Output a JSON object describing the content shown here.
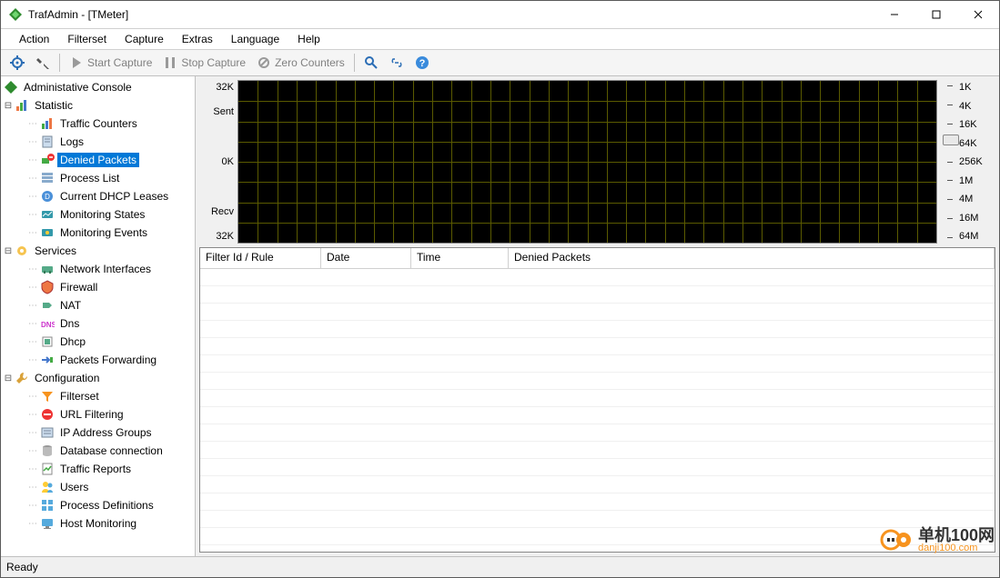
{
  "title": "TrafAdmin - [TMeter]",
  "menubar": [
    "Action",
    "Filterset",
    "Capture",
    "Extras",
    "Language",
    "Help"
  ],
  "toolbar": {
    "gear1": "settings-icon",
    "gear2": "wrench-icon",
    "start": "Start Capture",
    "stop": "Stop Capture",
    "zero": "Zero Counters",
    "search": "search-icon",
    "link": "link-icon",
    "help": "help-icon"
  },
  "tree": {
    "root": "Administative Console",
    "statistic": {
      "label": "Statistic",
      "items": [
        "Traffic Counters",
        "Logs",
        "Denied Packets",
        "Process List",
        "Current DHCP Leases",
        "Monitoring States",
        "Monitoring Events"
      ]
    },
    "services": {
      "label": "Services",
      "items": [
        "Network Interfaces",
        "Firewall",
        "NAT",
        "Dns",
        "Dhcp",
        "Packets Forwarding"
      ]
    },
    "configuration": {
      "label": "Configuration",
      "items": [
        "Filterset",
        "URL Filtering",
        "IP Address Groups",
        "Database connection",
        "Traffic Reports",
        "Users",
        "Process Definitions",
        "Host Monitoring"
      ]
    }
  },
  "selected_tree_item": "Denied Packets",
  "chart_data": {
    "type": "line",
    "title": "",
    "series": [
      {
        "name": "Sent",
        "values": []
      },
      {
        "name": "Recv",
        "values": []
      }
    ],
    "ylabels_left": [
      "32K",
      "Sent",
      "",
      "0K",
      "",
      "Recv",
      "32K"
    ],
    "y_sent_max": "32K",
    "y_sent_label": "Sent",
    "y_zero": "0K",
    "y_recv_label": "Recv",
    "y_recv_max": "32K",
    "scale_labels": [
      "1K",
      "4K",
      "16K",
      "64K",
      "256K",
      "1M",
      "4M",
      "16M",
      "64M"
    ],
    "scale_value": "64K",
    "xlabel": "",
    "ylabel": ""
  },
  "table": {
    "columns": [
      "Filter Id / Rule",
      "Date",
      "Time",
      "Denied Packets"
    ],
    "rows": []
  },
  "status": "Ready",
  "watermark": {
    "cn": "单机100网",
    "domain": "danji100.com"
  }
}
